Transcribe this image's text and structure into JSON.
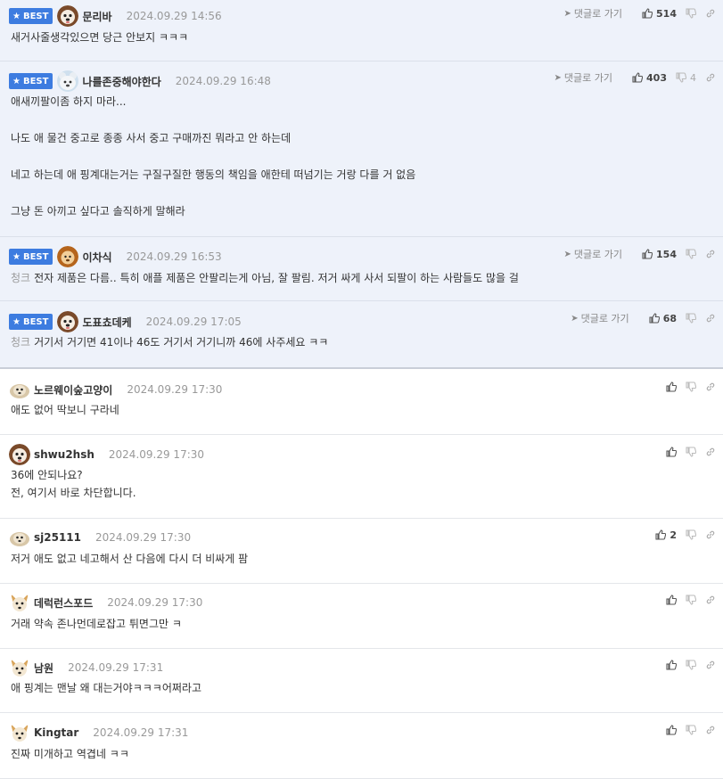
{
  "best_label": "BEST",
  "reply_label": "댓글로 가기",
  "colors": {
    "accent": "#3d7ce0",
    "best_bg": "#eef2fa"
  },
  "comments": [
    {
      "nick": "문리바",
      "time": "2024.09.29 14:56",
      "avatar": "dog-face-avatar",
      "best": true,
      "likes": "514",
      "dislikes": "",
      "prefix": "",
      "lines": [
        "새거사줄생각있으면 당근 안보지 ㅋㅋㅋ"
      ]
    },
    {
      "nick": "나를존중해야한다",
      "time": "2024.09.29 16:48",
      "avatar": "bear-avatar",
      "best": true,
      "likes": "403",
      "dislikes": "4",
      "prefix": "",
      "lines": [
        "애새끼팔이좀 하지 마라...",
        "",
        "나도 애 물건 중고로 종종 사서 중고 구매까진 뭐라고 안 하는데",
        "",
        "네고 하는데 애 핑계대는거는 구질구질한 행동의 책임을 애한테 떠넘기는 거랑 다를 거 없음",
        "",
        "그냥 돈 아끼고 싶다고 솔직하게 말해라"
      ]
    },
    {
      "nick": "이차식",
      "time": "2024.09.29 16:53",
      "avatar": "lion-avatar",
      "best": true,
      "likes": "154",
      "dislikes": "",
      "prefix": "청크",
      "lines": [
        "전자 제품은 다름.. 특히 애플 제품은 안팔리는게 아님, 잘 팔림. 저거 싸게 사서 되팔이 하는 사람들도 많을 걸"
      ]
    },
    {
      "nick": "도표쵸데케",
      "time": "2024.09.29 17:05",
      "avatar": "dog-face-avatar",
      "best": true,
      "likes": "68",
      "dislikes": "",
      "prefix": "청크",
      "lines": [
        "거기서 거기면 41이나 46도 거기서 거기니까 46에 사주세요 ㅋㅋ"
      ]
    },
    {
      "nick": "노르웨이숲고양이",
      "time": "2024.09.29 17:30",
      "avatar": "pet-avatar",
      "best": false,
      "likes": "",
      "dislikes": "",
      "prefix": "",
      "lines": [
        "애도 없어 딱보니 구라네"
      ]
    },
    {
      "nick": "shwu2hsh",
      "time": "2024.09.29 17:30",
      "avatar": "dog-face-avatar",
      "best": false,
      "likes": "",
      "dislikes": "",
      "prefix": "",
      "lines": [
        "36에 안되나요?",
        "전, 여기서 바로 차단합니다."
      ]
    },
    {
      "nick": "sj25111",
      "time": "2024.09.29 17:30",
      "avatar": "pet-avatar",
      "best": false,
      "likes": "2",
      "dislikes": "",
      "prefix": "",
      "lines": [
        "저거 애도 없고 네고해서 산 다음에 다시 더 비싸게 팜"
      ]
    },
    {
      "nick": "데럭런스포드",
      "time": "2024.09.29 17:30",
      "avatar": "fox-avatar",
      "best": false,
      "likes": "",
      "dislikes": "",
      "prefix": "",
      "lines": [
        "거래 약속 존나먼데로잡고 튀면그만 ㅋ"
      ]
    },
    {
      "nick": "남원",
      "time": "2024.09.29 17:31",
      "avatar": "fox-avatar",
      "best": false,
      "likes": "",
      "dislikes": "",
      "prefix": "",
      "lines": [
        "애 핑계는 맨날 왜 대는거야ㅋㅋㅋ어쩌라고"
      ]
    },
    {
      "nick": "Kingtar",
      "time": "2024.09.29 17:31",
      "avatar": "fox-avatar",
      "best": false,
      "likes": "",
      "dislikes": "",
      "prefix": "",
      "lines": [
        "진짜 미개하고 역겹네 ㅋㅋ"
      ]
    }
  ]
}
